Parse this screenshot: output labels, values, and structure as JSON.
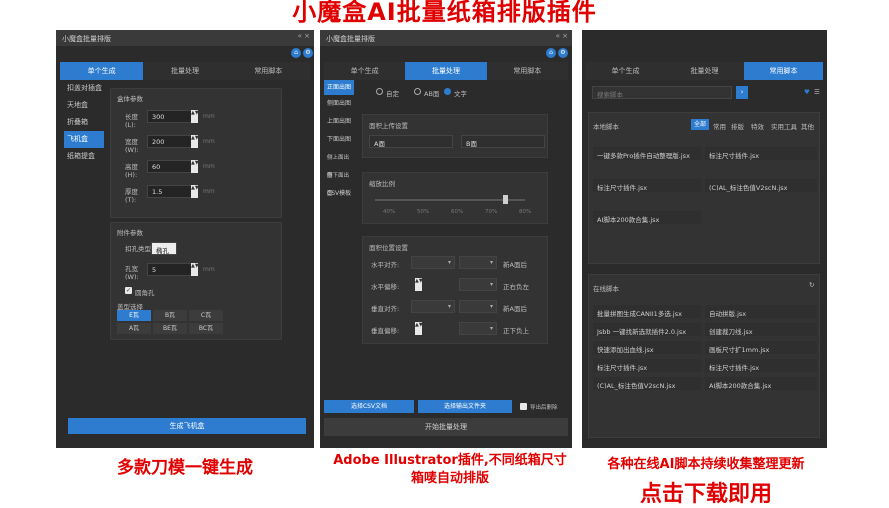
{
  "headline": "小魔盒AI批量纸箱排版插件",
  "panel1": {
    "window_title": "小魔盒批量排版",
    "tabs": [
      "单个生成",
      "批量处理",
      "常用脚本"
    ],
    "sidebar": [
      "扣盖对插盒",
      "天地盒",
      "折叠箱",
      "飞机盒",
      "纸箱提盒"
    ],
    "params_title": "盒体参数",
    "fields": [
      {
        "label": "长度(L):",
        "value": "300"
      },
      {
        "label": "宽度(W):",
        "value": "200"
      },
      {
        "label": "高度(H):",
        "value": "60"
      },
      {
        "label": "厚度(T):",
        "value": "1.5"
      }
    ],
    "unit": "mm",
    "parts_title": "附件参数",
    "hole_type_label": "扣孔类型:",
    "hole_type_value": "椭孔",
    "hole_width_label": "孔宽(W):",
    "hole_width_value": "5",
    "checkbox_label": "圆角孔",
    "lid_label": "盖型选择",
    "lid_options": [
      "E瓦",
      "B瓦",
      "C瓦",
      "A瓦",
      "BE瓦",
      "BC瓦"
    ],
    "generate_button": "生成飞机盒"
  },
  "panel2": {
    "window_title": "小魔盒批量排版",
    "tabs": [
      "单个生成",
      "批量处理",
      "常用脚本"
    ],
    "sidebar": [
      "正面出图",
      "侧面出图",
      "上面出图",
      "下面出图",
      "侧上面出图",
      "侧下面出图",
      "CSV模板"
    ],
    "radios": [
      "自定",
      "AB面",
      "文字"
    ],
    "group1_title": "面积上传设置",
    "input_a_label": "A面",
    "input_b_label": "B面",
    "group2_title": "缩放比例",
    "scale_ticks": [
      "40%",
      "50%",
      "60%",
      "70%",
      "80%"
    ],
    "group3_title": "面积位置设置",
    "pos_rows": [
      {
        "label": "水平对齐:",
        "v": "新A面后"
      },
      {
        "label": "水平偏移:",
        "v": "正右负左"
      },
      {
        "label": "垂直对齐:",
        "v": "新A面后"
      },
      {
        "label": "垂直偏移:",
        "v": "正下负上"
      }
    ],
    "csv_button": "选择CSV文档",
    "folder_button": "选择输出文件夹",
    "export_check": "导出后删除",
    "start_button": "开始批量处理"
  },
  "panel3": {
    "tabs": [
      "单个生成",
      "批量处理",
      "常用脚本"
    ],
    "search_placeholder": "搜索脚本",
    "local_title": "本地脚本",
    "filters": [
      "全部",
      "常用",
      "排版",
      "特效",
      "实用工具",
      "其他"
    ],
    "local_scripts": [
      "一键多款Pro插件自动整理版.jsx",
      "标注尺寸插件.jsx",
      "标注尺寸插件.jsx",
      "(C)AL_标注色值V2scN.jsx",
      "AI脚本200款合集.jsx"
    ],
    "online_title": "在线脚本",
    "online_scripts": [
      "批量拼图生成CANII1多选.jsx",
      "自动拼版.jsx",
      "Jsbb 一键找新选就插件2.0.jsx",
      "创建裁刀线.jsx",
      "快速添加出血线.jsx",
      "画板尺寸扩1mm.jsx",
      "标注尺寸插件.jsx",
      "标注尺寸插件.jsx",
      "(C)AL_标注色值V2scN.jsx",
      "AI脚本200款合集.jsx"
    ]
  },
  "captions": {
    "c1": "多款刀模一键生成",
    "c2": "Adobe Illustrator插件,不同纸箱尺寸箱唛自动排版",
    "c3": "各种在线AI脚本持续收集整理更新",
    "c4": "点击下载即用"
  },
  "colors": {
    "accent": "#2d7ccf",
    "red": "#e00000",
    "panel": "#2b2b2b"
  }
}
